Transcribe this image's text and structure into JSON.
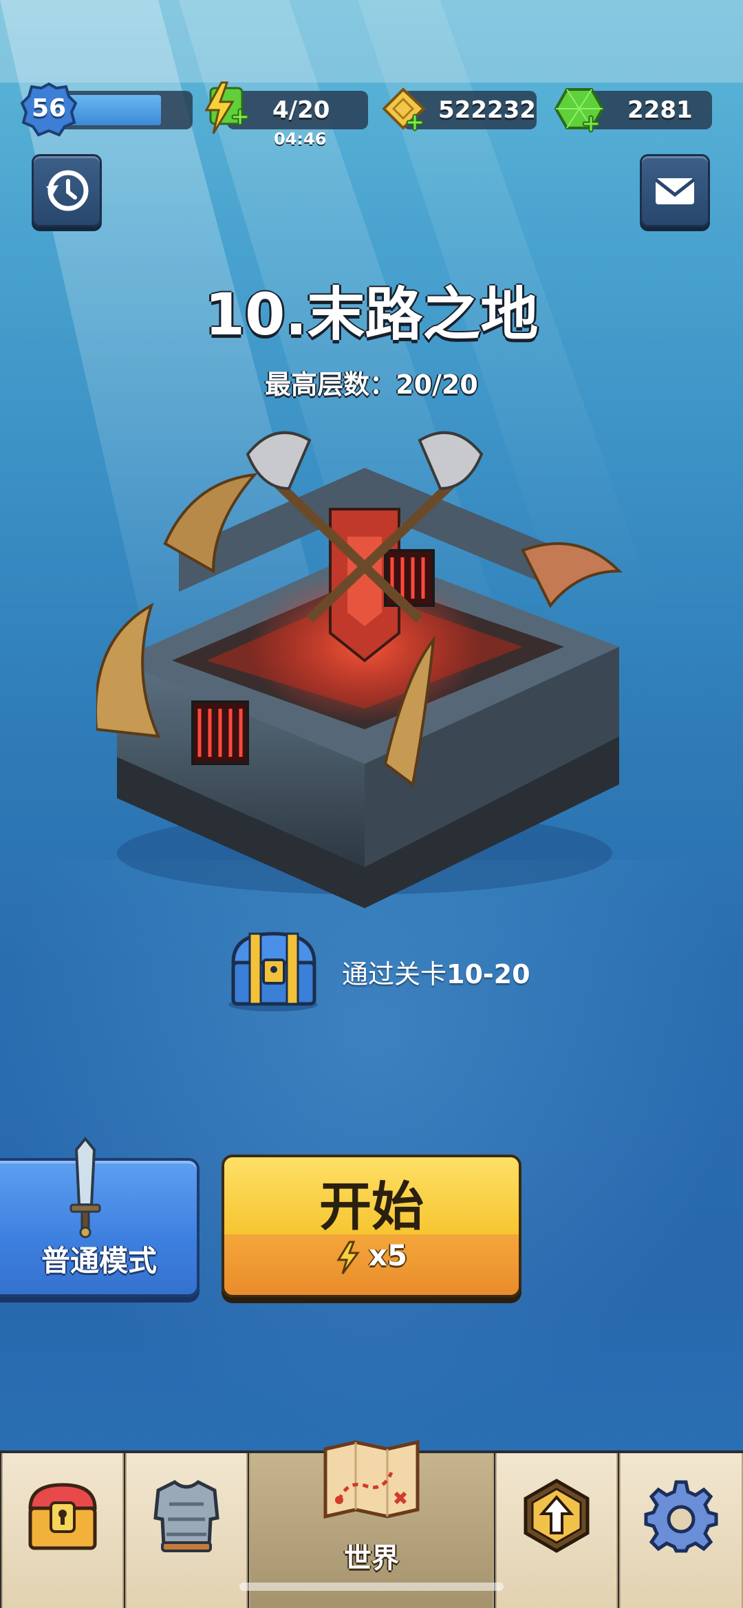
{
  "player": {
    "level": "56"
  },
  "resources": {
    "energy": {
      "value": "4/20",
      "timer": "04:46"
    },
    "gold": {
      "value": "522232"
    },
    "gems": {
      "value": "2281"
    }
  },
  "stage": {
    "title": "10.末路之地",
    "best_floor": "最高层数：20/20"
  },
  "reward": {
    "text_prefix": "通过关卡",
    "text_level": "10-20"
  },
  "buttons": {
    "mode_label": "普通模式",
    "start_label": "开始",
    "start_cost": "x5"
  },
  "nav": {
    "world_label": "世界"
  },
  "colors": {
    "ocean": "#2a6eb0",
    "start_top": "#f6c531",
    "start_bottom": "#e8892a",
    "mode_blue": "#3d7fde",
    "gem_green": "#5fd13b",
    "gold": "#f2c64a"
  }
}
